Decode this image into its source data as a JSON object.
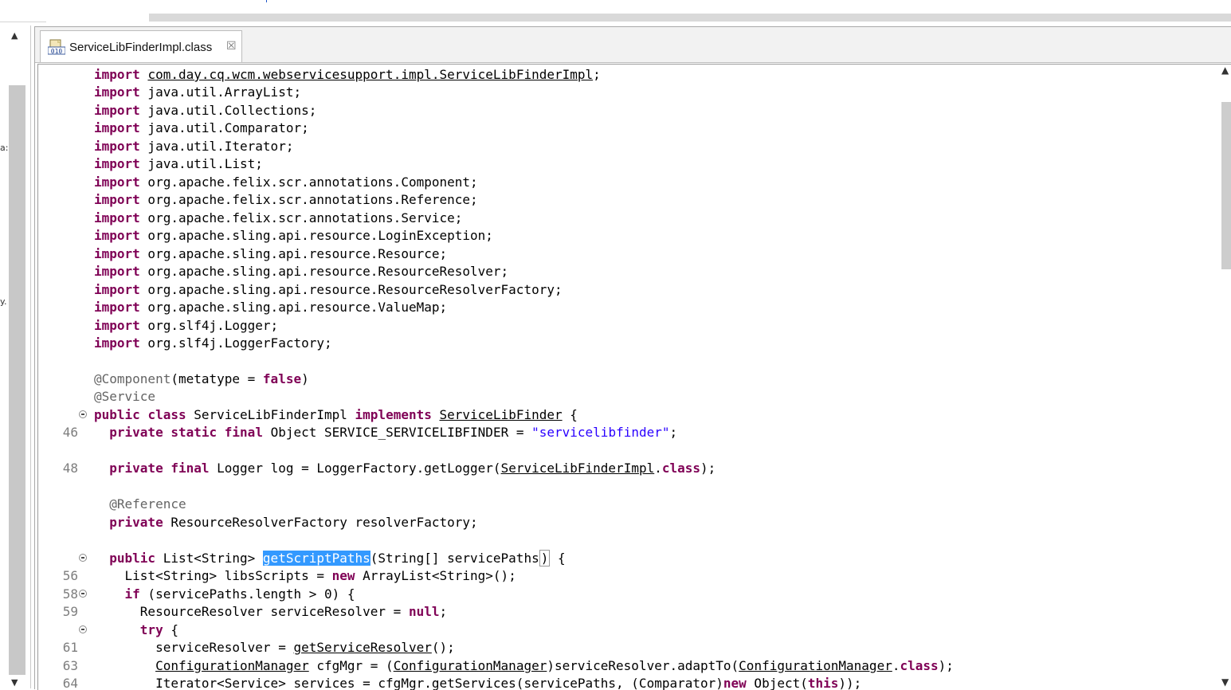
{
  "editor": {
    "tab": {
      "title": "ServiceLibFinderImpl.class",
      "icon": "class-file-icon",
      "close_icon": "close-icon"
    }
  },
  "left_panel": {
    "fragments": [
      "a:",
      "y."
    ]
  },
  "colors": {
    "keyword": "#7f0055",
    "string": "#2a00ff",
    "annotation": "#646464",
    "selection": "#3399ff"
  },
  "code": {
    "lines": [
      {
        "ln": "",
        "fold": false,
        "tokens": [
          {
            "t": "import",
            "c": "kw"
          },
          {
            "t": " "
          },
          {
            "t": "com.day.cq.wcm.webservicesupport.impl.ServiceLibFinderImpl",
            "c": "u"
          },
          {
            "t": ";"
          }
        ]
      },
      {
        "ln": "",
        "fold": false,
        "tokens": [
          {
            "t": "import",
            "c": "kw"
          },
          {
            "t": " java.util.ArrayList;"
          }
        ]
      },
      {
        "ln": "",
        "fold": false,
        "tokens": [
          {
            "t": "import",
            "c": "kw"
          },
          {
            "t": " java.util.Collections;"
          }
        ]
      },
      {
        "ln": "",
        "fold": false,
        "tokens": [
          {
            "t": "import",
            "c": "kw"
          },
          {
            "t": " java.util.Comparator;"
          }
        ]
      },
      {
        "ln": "",
        "fold": false,
        "tokens": [
          {
            "t": "import",
            "c": "kw"
          },
          {
            "t": " java.util.Iterator;"
          }
        ]
      },
      {
        "ln": "",
        "fold": false,
        "tokens": [
          {
            "t": "import",
            "c": "kw"
          },
          {
            "t": " java.util.List;"
          }
        ]
      },
      {
        "ln": "",
        "fold": false,
        "tokens": [
          {
            "t": "import",
            "c": "kw"
          },
          {
            "t": " org.apache.felix.scr.annotations.Component;"
          }
        ]
      },
      {
        "ln": "",
        "fold": false,
        "tokens": [
          {
            "t": "import",
            "c": "kw"
          },
          {
            "t": " org.apache.felix.scr.annotations.Reference;"
          }
        ]
      },
      {
        "ln": "",
        "fold": false,
        "tokens": [
          {
            "t": "import",
            "c": "kw"
          },
          {
            "t": " org.apache.felix.scr.annotations.Service;"
          }
        ]
      },
      {
        "ln": "",
        "fold": false,
        "tokens": [
          {
            "t": "import",
            "c": "kw"
          },
          {
            "t": " org.apache.sling.api.resource.LoginException;"
          }
        ]
      },
      {
        "ln": "",
        "fold": false,
        "tokens": [
          {
            "t": "import",
            "c": "kw"
          },
          {
            "t": " org.apache.sling.api.resource.Resource;"
          }
        ]
      },
      {
        "ln": "",
        "fold": false,
        "tokens": [
          {
            "t": "import",
            "c": "kw"
          },
          {
            "t": " org.apache.sling.api.resource.ResourceResolver;"
          }
        ]
      },
      {
        "ln": "",
        "fold": false,
        "tokens": [
          {
            "t": "import",
            "c": "kw"
          },
          {
            "t": " org.apache.sling.api.resource.ResourceResolverFactory;"
          }
        ]
      },
      {
        "ln": "",
        "fold": false,
        "tokens": [
          {
            "t": "import",
            "c": "kw"
          },
          {
            "t": " org.apache.sling.api.resource.ValueMap;"
          }
        ]
      },
      {
        "ln": "",
        "fold": false,
        "tokens": [
          {
            "t": "import",
            "c": "kw"
          },
          {
            "t": " org.slf4j.Logger;"
          }
        ]
      },
      {
        "ln": "",
        "fold": false,
        "tokens": [
          {
            "t": "import",
            "c": "kw"
          },
          {
            "t": " org.slf4j.LoggerFactory;"
          }
        ]
      },
      {
        "ln": "",
        "fold": false,
        "tokens": []
      },
      {
        "ln": "",
        "fold": false,
        "tokens": [
          {
            "t": "@Component",
            "c": "ann"
          },
          {
            "t": "(metatype = "
          },
          {
            "t": "false",
            "c": "kw"
          },
          {
            "t": ")"
          }
        ]
      },
      {
        "ln": "",
        "fold": false,
        "tokens": [
          {
            "t": "@Service",
            "c": "ann"
          }
        ]
      },
      {
        "ln": "",
        "fold": true,
        "tokens": [
          {
            "t": "public",
            "c": "kw"
          },
          {
            "t": " "
          },
          {
            "t": "class",
            "c": "kw"
          },
          {
            "t": " ServiceLibFinderImpl "
          },
          {
            "t": "implements",
            "c": "kw"
          },
          {
            "t": " "
          },
          {
            "t": "ServiceLibFinder",
            "c": "u"
          },
          {
            "t": " {"
          }
        ]
      },
      {
        "ln": "46",
        "fold": false,
        "tokens": [
          {
            "t": "  "
          },
          {
            "t": "private",
            "c": "kw"
          },
          {
            "t": " "
          },
          {
            "t": "static",
            "c": "kw"
          },
          {
            "t": " "
          },
          {
            "t": "final",
            "c": "kw"
          },
          {
            "t": " Object SERVICE_SERVICELIBFINDER = "
          },
          {
            "t": "\"servicelibfinder\"",
            "c": "str"
          },
          {
            "t": ";"
          }
        ]
      },
      {
        "ln": "",
        "fold": false,
        "tokens": []
      },
      {
        "ln": "48",
        "fold": false,
        "tokens": [
          {
            "t": "  "
          },
          {
            "t": "private",
            "c": "kw"
          },
          {
            "t": " "
          },
          {
            "t": "final",
            "c": "kw"
          },
          {
            "t": " Logger log = LoggerFactory.getLogger("
          },
          {
            "t": "ServiceLibFinderImpl",
            "c": "u"
          },
          {
            "t": "."
          },
          {
            "t": "class",
            "c": "kw"
          },
          {
            "t": ");"
          }
        ]
      },
      {
        "ln": "",
        "fold": false,
        "tokens": []
      },
      {
        "ln": "",
        "fold": false,
        "tokens": [
          {
            "t": "  "
          },
          {
            "t": "@Reference",
            "c": "ann"
          }
        ]
      },
      {
        "ln": "",
        "fold": false,
        "tokens": [
          {
            "t": "  "
          },
          {
            "t": "private",
            "c": "kw"
          },
          {
            "t": " ResourceResolverFactory resolverFactory;"
          }
        ]
      },
      {
        "ln": "",
        "fold": false,
        "tokens": []
      },
      {
        "ln": "",
        "fold": true,
        "tokens": [
          {
            "t": "  "
          },
          {
            "t": "public",
            "c": "kw"
          },
          {
            "t": " List<String> "
          },
          {
            "t": "getScriptPaths",
            "c": "sel"
          },
          {
            "t": "(String[] servicePaths"
          },
          {
            "t": ")",
            "c": "cur"
          },
          {
            "t": " {"
          }
        ]
      },
      {
        "ln": "56",
        "fold": false,
        "tokens": [
          {
            "t": "    List<String> libsScripts = "
          },
          {
            "t": "new",
            "c": "kw"
          },
          {
            "t": " ArrayList<String>();"
          }
        ]
      },
      {
        "ln": "58",
        "fold": true,
        "tokens": [
          {
            "t": "    "
          },
          {
            "t": "if",
            "c": "kw"
          },
          {
            "t": " (servicePaths.length > 0) {"
          }
        ]
      },
      {
        "ln": "59",
        "fold": false,
        "tokens": [
          {
            "t": "      ResourceResolver serviceResolver = "
          },
          {
            "t": "null",
            "c": "kw"
          },
          {
            "t": ";"
          }
        ]
      },
      {
        "ln": "",
        "fold": true,
        "tokens": [
          {
            "t": "      "
          },
          {
            "t": "try",
            "c": "kw"
          },
          {
            "t": " {"
          }
        ]
      },
      {
        "ln": "61",
        "fold": false,
        "tokens": [
          {
            "t": "        serviceResolver = "
          },
          {
            "t": "getServiceResolver",
            "c": "u"
          },
          {
            "t": "();"
          }
        ]
      },
      {
        "ln": "63",
        "fold": false,
        "tokens": [
          {
            "t": "        "
          },
          {
            "t": "ConfigurationManager",
            "c": "u"
          },
          {
            "t": " cfgMgr = ("
          },
          {
            "t": "ConfigurationManager",
            "c": "u"
          },
          {
            "t": ")serviceResolver.adaptTo("
          },
          {
            "t": "ConfigurationManager",
            "c": "u"
          },
          {
            "t": "."
          },
          {
            "t": "class",
            "c": "kw"
          },
          {
            "t": ");"
          }
        ]
      },
      {
        "ln": "64",
        "fold": false,
        "tokens": [
          {
            "t": "        Iterator<Service> services = cfgMgr.getServices(servicePaths, (Comparator)"
          },
          {
            "t": "new",
            "c": "kw"
          },
          {
            "t": " Object("
          },
          {
            "t": "this",
            "c": "kw"
          },
          {
            "t": "));"
          }
        ]
      }
    ]
  }
}
